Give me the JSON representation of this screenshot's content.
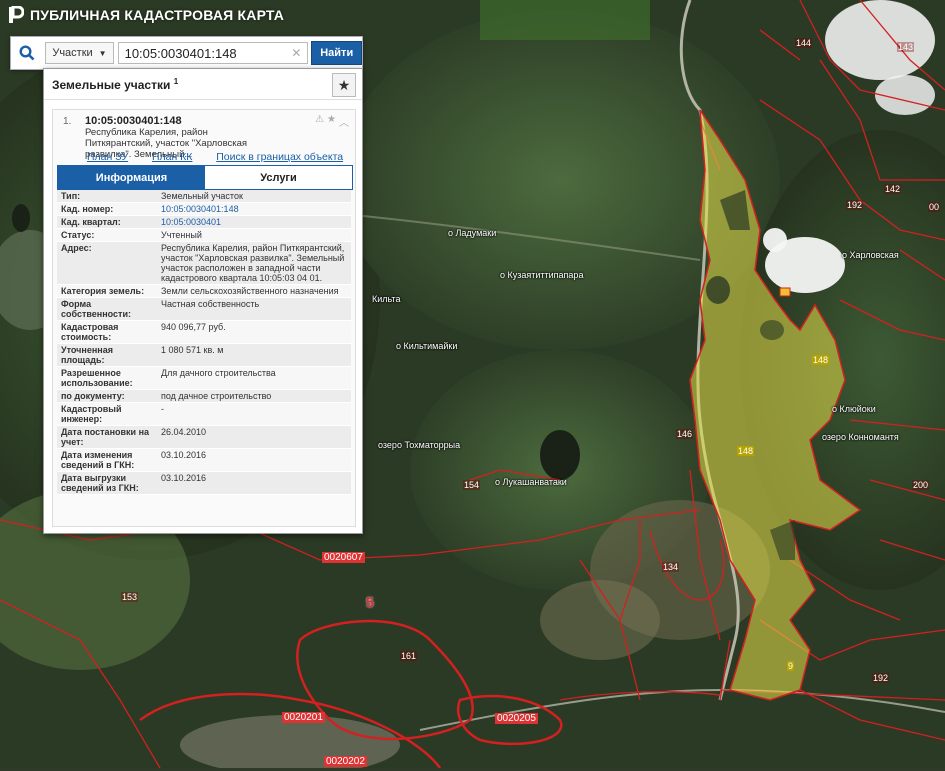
{
  "app": {
    "title": "ПУБЛИЧНАЯ КАДАСТРОВАЯ КАРТА"
  },
  "search": {
    "type_label": "Участки",
    "value": "10:05:0030401:148",
    "button_label": "Найти"
  },
  "panel": {
    "title": "Земельные участки",
    "count": "1"
  },
  "card": {
    "index": "1.",
    "cadastral_number": "10:05:0030401:148",
    "address_short": "Республика Карелия, район Питкярантский, участок \"Харловская развилка\". Земельный...",
    "links": [
      "План ЗУ →",
      "План КК →",
      "Поиск в границах объекта →"
    ],
    "tabs": [
      "Информация",
      "Услуги"
    ],
    "rows": [
      {
        "key": "Тип:",
        "value": "Земельный участок"
      },
      {
        "key": "Кад. номер:",
        "value": "10:05:0030401:148"
      },
      {
        "key": "Кад. квартал:",
        "value": "10:05:0030401"
      },
      {
        "key": "Статус:",
        "value": "Учтенный"
      },
      {
        "key": "Адрес:",
        "value": "Республика Карелия, район Питкярантский, участок \"Харловская развилка\". Земельный участок расположен в западной части кадастрового квартала 10:05:03 04 01."
      },
      {
        "key": "Категория земель:",
        "value": "Земли сельскохозяйственного назначения"
      },
      {
        "key": "Форма собственности:",
        "value": "Частная собственность"
      },
      {
        "key": "Кадастровая стоимость:",
        "value": "940 096,77 руб."
      },
      {
        "key": "Уточненная площадь:",
        "value": "1 080 571 кв. м"
      },
      {
        "key": "Разрешенное использование:",
        "value": "Для дачного строительства"
      },
      {
        "key": "по документу:",
        "value": "под дачное строительство"
      },
      {
        "key": "Кадастровый инженер:",
        "value": "-"
      },
      {
        "key": "Дата постановки на учет:",
        "value": "26.04.2010"
      },
      {
        "key": "Дата изменения сведений в ГКН:",
        "value": "03.10.2016"
      },
      {
        "key": "Дата выгрузки сведений из ГКН:",
        "value": "03.10.2016"
      }
    ]
  },
  "map": {
    "parcel_labels": [
      "144",
      "143",
      "142",
      "192",
      "00",
      "146",
      "148",
      "148",
      "134",
      "154",
      "153",
      "200",
      "192",
      "161",
      "9"
    ],
    "quarter_labels": [
      "0020607",
      "0020201",
      "0020205",
      "0020202",
      "5"
    ]
  },
  "colors": {
    "accent": "#1b5fa7",
    "parcel_fill": "#e8e24a",
    "boundary": "#d32020"
  }
}
